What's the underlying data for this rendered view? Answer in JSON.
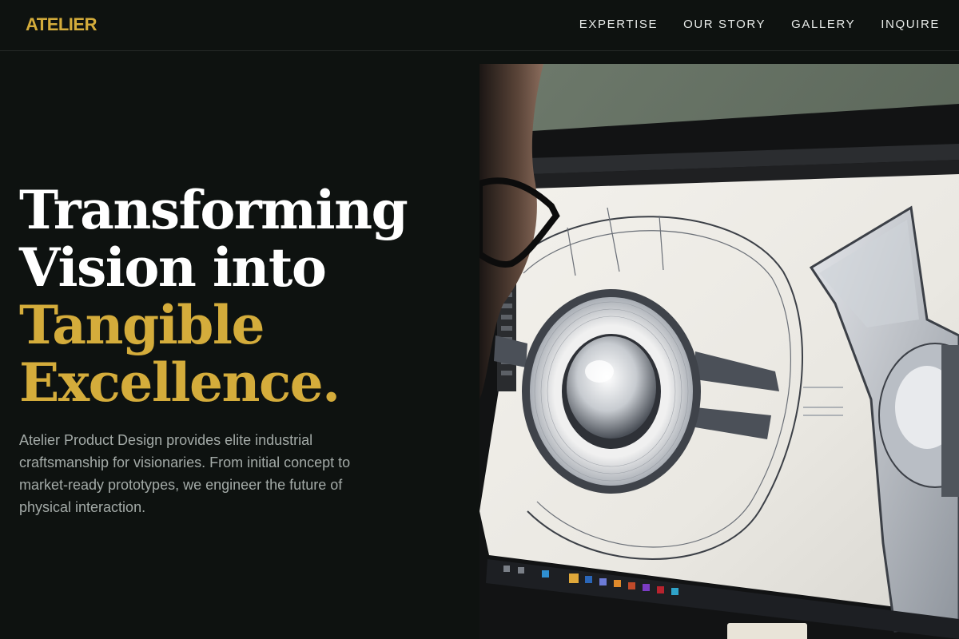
{
  "header": {
    "brand": "ATELIER",
    "nav": [
      {
        "label": "EXPERTISE"
      },
      {
        "label": "OUR STORY"
      },
      {
        "label": "GALLERY"
      },
      {
        "label": "INQUIRE"
      }
    ]
  },
  "hero": {
    "title_line1": "Transforming",
    "title_line2": "Vision into",
    "title_line3": "Tangible",
    "title_line4": "Excellence.",
    "description": "Atelier Product Design provides elite industrial craftsmanship for visionaries. From initial concept to market-ready prototypes, we engineer the future of physical interaction."
  },
  "colors": {
    "background": "#0e1210",
    "accent_gold": "#d4ac3b",
    "text_muted": "#a3aaa7"
  },
  "image": {
    "subject": "designer-at-monitor-with-cad-sketch"
  }
}
